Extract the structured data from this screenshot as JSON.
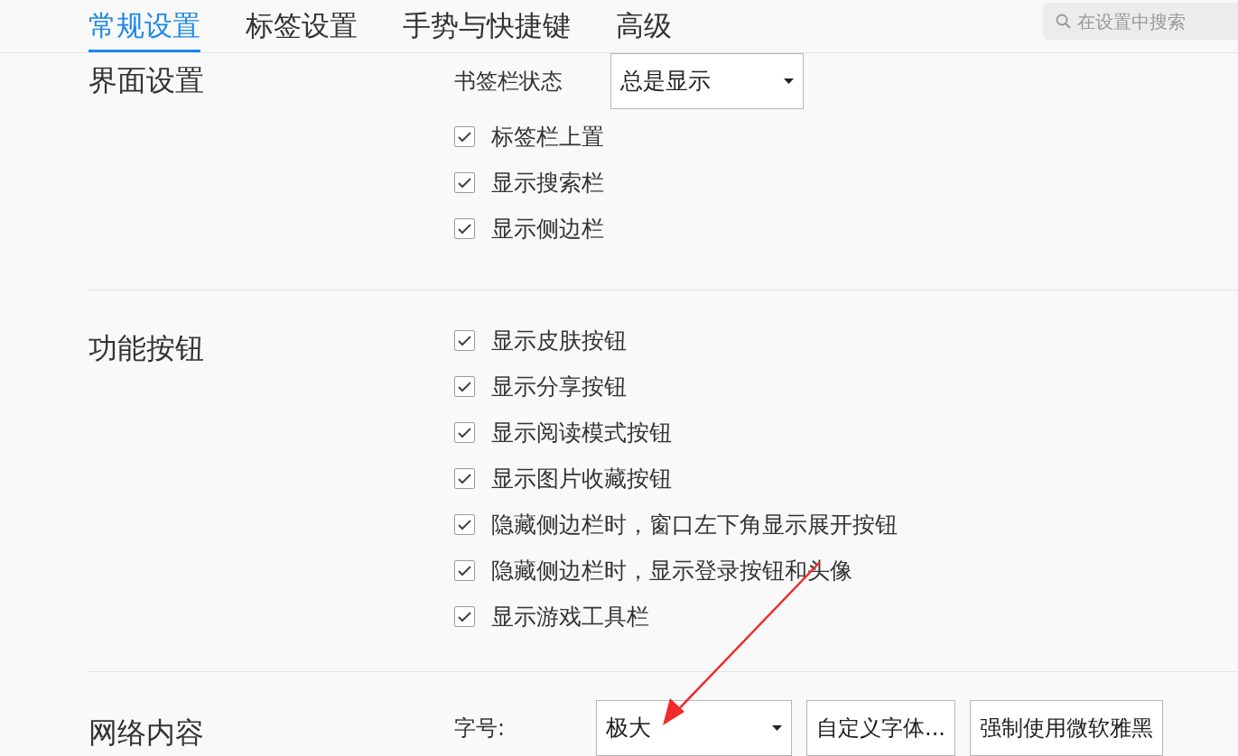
{
  "tabs": [
    {
      "label": "常规设置",
      "selected": true
    },
    {
      "label": "标签设置",
      "selected": false
    },
    {
      "label": "手势与快捷键",
      "selected": false
    },
    {
      "label": "高级",
      "selected": false
    }
  ],
  "search": {
    "placeholder": "在设置中搜索"
  },
  "sections": [
    {
      "title": "界面设置",
      "select": {
        "label": "书签栏状态",
        "value": "总是显示"
      },
      "options": [
        {
          "label": "标签栏上置",
          "checked": true
        },
        {
          "label": "显示搜索栏",
          "checked": true
        },
        {
          "label": "显示侧边栏",
          "checked": true
        }
      ]
    },
    {
      "title": "功能按钮",
      "options": [
        {
          "label": "显示皮肤按钮",
          "checked": true
        },
        {
          "label": "显示分享按钮",
          "checked": true
        },
        {
          "label": "显示阅读模式按钮",
          "checked": true
        },
        {
          "label": "显示图片收藏按钮",
          "checked": true
        },
        {
          "label": "隐藏侧边栏时，窗口左下角显示展开按钮",
          "checked": true
        },
        {
          "label": "隐藏侧边栏时，显示登录按钮和头像",
          "checked": true
        },
        {
          "label": "显示游戏工具栏",
          "checked": true
        }
      ]
    },
    {
      "title": "网络内容",
      "select": {
        "label": "字号:",
        "value": "极大"
      },
      "buttons": [
        "自定义字体...",
        "强制使用微软雅黑"
      ]
    }
  ]
}
